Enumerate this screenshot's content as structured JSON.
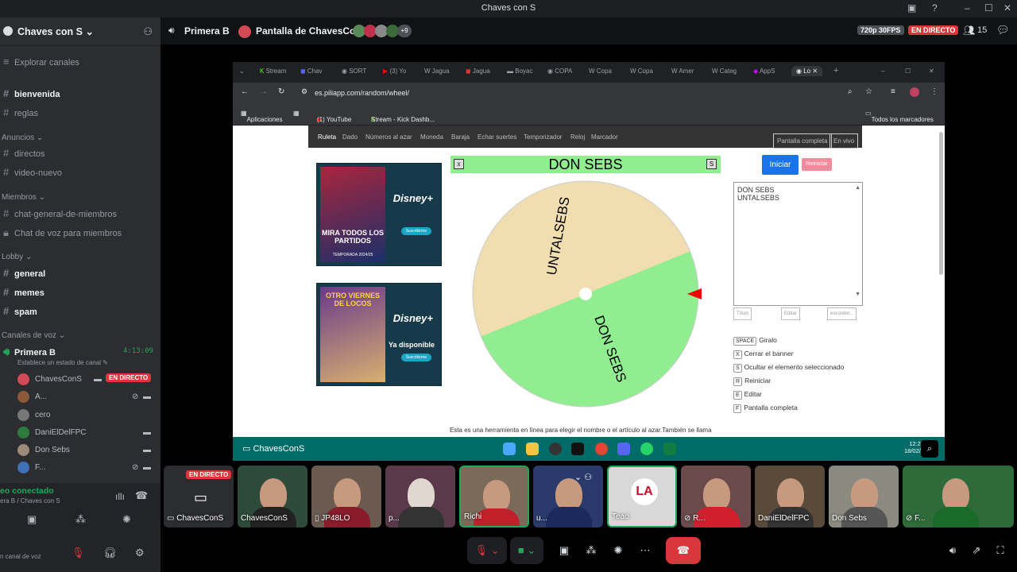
{
  "window": {
    "title": "Chaves con S"
  },
  "sidebar": {
    "server_name": "Chaves con S",
    "explore": "Explorar canales",
    "channels_top": [
      "bienvenida",
      "reglas"
    ],
    "category_anuncios": "Anuncios",
    "channels_anuncios": [
      "directos",
      "video-nuevo"
    ],
    "category_miembros": "Miembros",
    "channels_miembros": [
      "chat-general-de-miembros",
      "Chat de voz para miembros"
    ],
    "category_lobby": "Lobby",
    "channels_lobby": [
      "general",
      "memes",
      "spam"
    ],
    "category_voz": "Canales de voz",
    "voice_channel": "Primera B",
    "voice_timer": "4:13:09",
    "voice_status": "Establece un estado de canal",
    "voice_users": [
      "ChavesConS",
      "A...",
      "cero",
      "DaniElDelFPC",
      "Don Sebs",
      "F..."
    ],
    "live_badge": "EN DIRECTO",
    "connection_status": "eo conectado",
    "connection_sub": "era B / Chaves con S",
    "bottom_text": "n canal de voz"
  },
  "header": {
    "channel": "Primera B",
    "screen_title": "Pantalla de ChavesConS",
    "viewers_extra": "+9",
    "quality": "720p 30FPS",
    "live": "EN DIRECTO",
    "viewer_count": "15"
  },
  "browser": {
    "tabs": [
      "Stream",
      "Chav",
      "SORT",
      "(3) Yo",
      "Jagua",
      "Jagua",
      "Boyac",
      "COPA",
      "Copa",
      "Copa",
      "Amer",
      "Categ",
      "AppS",
      "Lo"
    ],
    "url": "es.piliapp.com/random/wheel/",
    "bookmarks": [
      "Aplicaciones",
      "(1) YouTube",
      "Stream - Kick Dashb...",
      "Todos los marcadores"
    ]
  },
  "site": {
    "nav": [
      "Ruleta",
      "Dado",
      "Números al azar",
      "Moneda",
      "Baraja",
      "Echar suertes",
      "Temporizador",
      "Reloj",
      "Marcador"
    ],
    "btn_fullscreen": "Pantalla completa",
    "btn_live": "En vivo",
    "winner": "DON SEBS",
    "close_x": "x",
    "s_key": "S",
    "btn_start": "Iniciar",
    "btn_reset": "Reiniciar",
    "entries": [
      "DON SEBS",
      "UNTALSEBS"
    ],
    "small_buttons": [
      "Título",
      "Editar",
      "esconder..."
    ],
    "shortcuts": [
      {
        "key": "SPACE",
        "label": "Giralo"
      },
      {
        "key": "X",
        "label": "Cerrar el banner"
      },
      {
        "key": "S",
        "label": "Ocultar el elemento seleccionado"
      },
      {
        "key": "R",
        "label": "Reiniciar"
      },
      {
        "key": "E",
        "label": "Editar"
      },
      {
        "key": "F",
        "label": "Pantalla completa"
      }
    ],
    "description": "Esta es una herramienta en línea para elegir el nombre o el artículo al azar.También se llama",
    "ad1_text": "MIRA TODOS LOS PARTIDOS",
    "ad1_sub": "TEMPORADA 2024/25",
    "ad1_btn": "Suscribirme",
    "ad2_text": "OTRO VIERNES DE LOCOS",
    "ad2_sub": "Ya disponible",
    "ad2_btn": "Suscribirme",
    "brand": "Disney+"
  },
  "taskbar": {
    "label": "ChavesConS",
    "time": "12:2",
    "date": "18/02/"
  },
  "participants": [
    "ChavesConS",
    "ChavesConS",
    "JP48LO",
    "p...",
    "Richi",
    "u...",
    "Teao",
    "R...",
    "DaniElDelFPC",
    "Don Sebs",
    "F..."
  ],
  "wheel_colors": {
    "slice1": "#f1deb0",
    "slice2": "#90ee90"
  }
}
